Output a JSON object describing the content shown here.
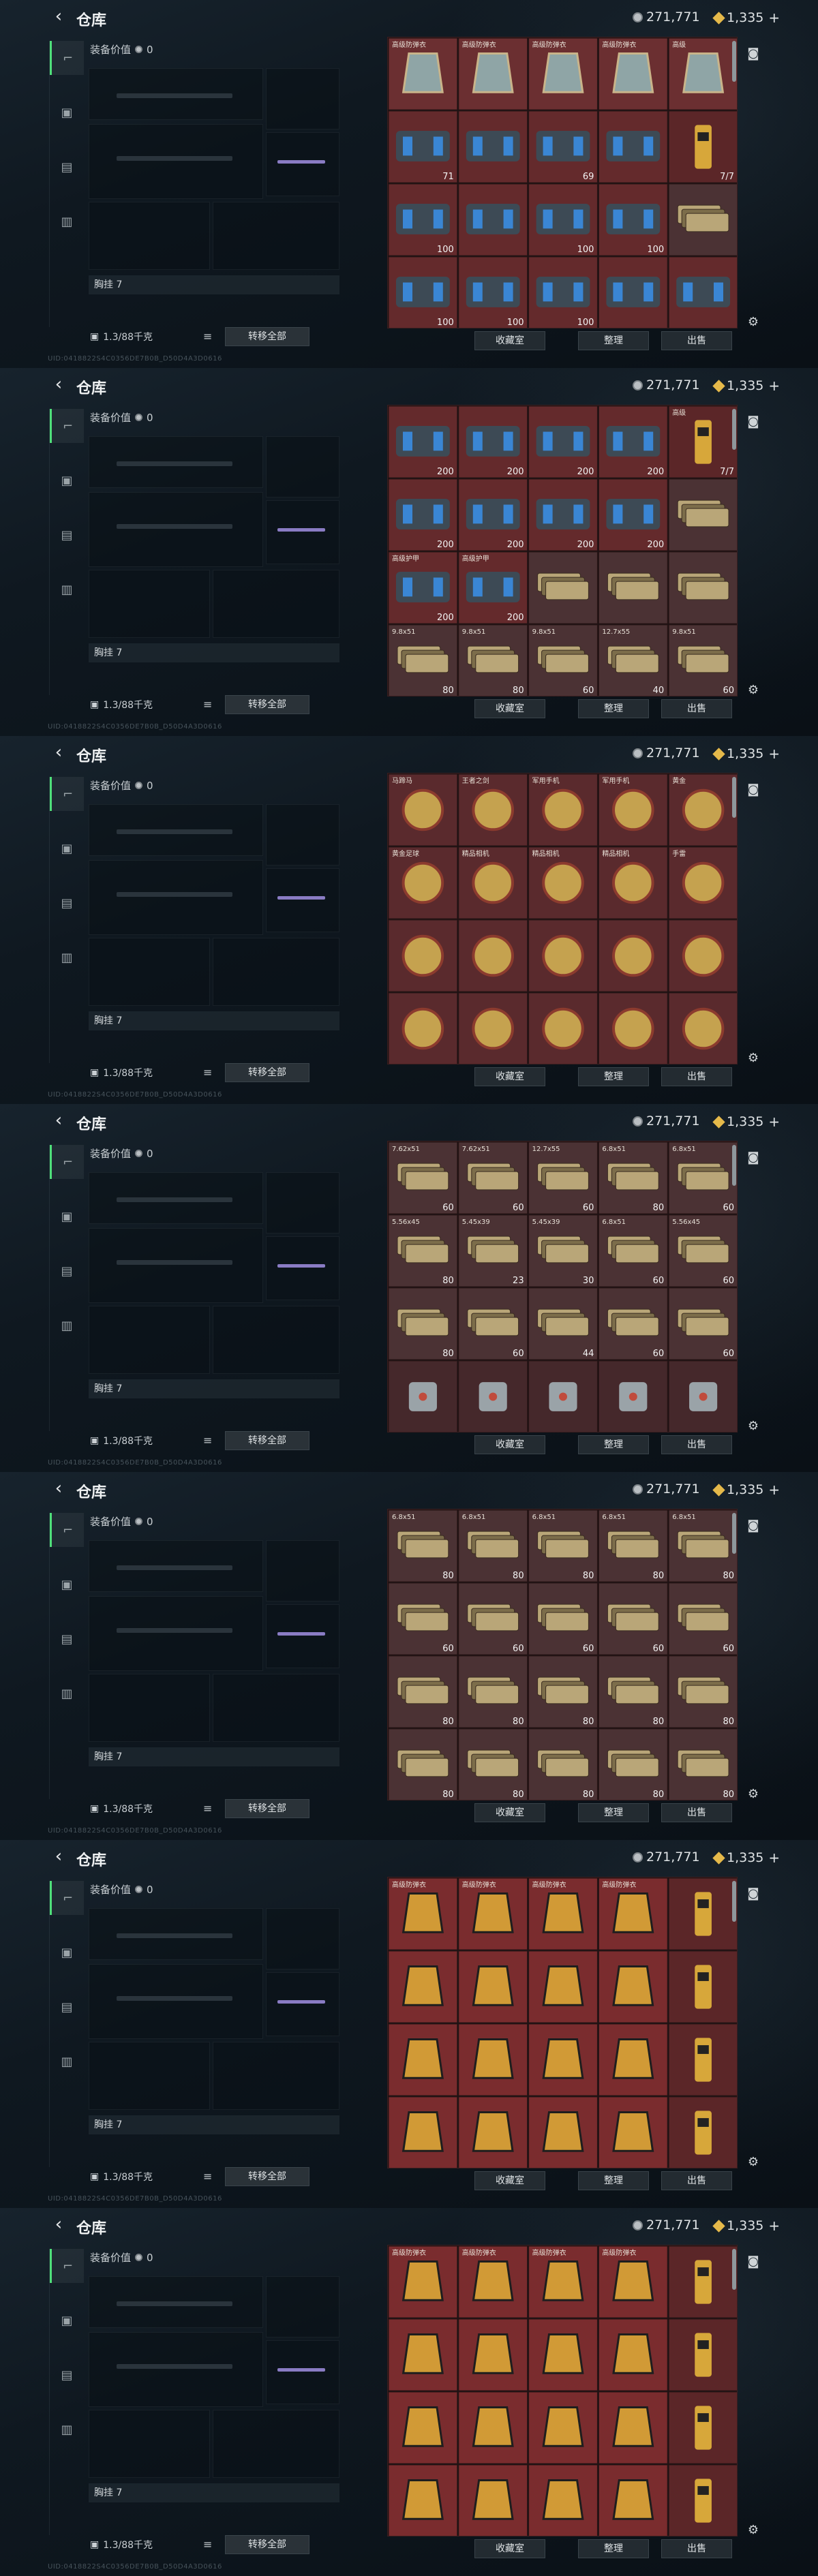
{
  "header": {
    "title": "仓库",
    "currency_1": "271,771",
    "currency_2": "1,335",
    "plus": "+"
  },
  "loadout": {
    "gear_value_label": "装备价值",
    "gear_value": "0",
    "chest_label": "胸挂 7",
    "capacity": "1.3/88千克",
    "transfer_all": "转移全部",
    "uid": "UID:0418822S4C0356DE7B0B_D50D4A3D0616"
  },
  "footer": {
    "collect": "收藏室",
    "organize": "整理",
    "sell": "出售"
  },
  "screens": [
    {
      "rows": [
        [
          "armor",
          "armor",
          "armor",
          "armor",
          "armor"
        ],
        [
          "case",
          "case",
          "case",
          "case",
          "tool"
        ],
        [
          "case",
          "case",
          "case",
          "case",
          "ammo"
        ],
        [
          "case",
          "case",
          "case",
          "case",
          "case"
        ]
      ],
      "labels": [
        [
          "高级防弹衣",
          "高级防弹衣",
          "高级防弹衣",
          "高级防弹衣",
          "高级"
        ],
        [
          "",
          "",
          "",
          "",
          ""
        ],
        [
          "",
          "",
          "",
          "",
          ""
        ],
        [
          "",
          "",
          "",
          "",
          ""
        ]
      ],
      "numbers": [
        [
          "",
          "",
          "",
          "",
          ""
        ],
        [
          "71",
          "",
          "69",
          "",
          "7/7"
        ],
        [
          "100",
          "",
          "100",
          "100",
          ""
        ],
        [
          "100",
          "100",
          "100",
          "",
          ""
        ]
      ]
    },
    {
      "rows": [
        [
          "case",
          "case",
          "case",
          "case",
          "tool"
        ],
        [
          "case",
          "case",
          "case",
          "case",
          "ammo"
        ],
        [
          "case",
          "case",
          "ammo",
          "ammo",
          "ammo"
        ],
        [
          "ammo",
          "ammo",
          "ammo",
          "ammo",
          "ammo"
        ]
      ],
      "labels": [
        [
          "",
          "",
          "",
          "",
          "高级"
        ],
        [
          "",
          "",
          "",
          "",
          ""
        ],
        [
          "高级护甲",
          "高级护甲",
          "",
          "",
          ""
        ],
        [
          "9.8x51",
          "9.8x51",
          "9.8x51",
          "12.7x55",
          "9.8x51"
        ]
      ],
      "numbers": [
        [
          "200",
          "200",
          "200",
          "200",
          "7/7"
        ],
        [
          "200",
          "200",
          "200",
          "200",
          ""
        ],
        [
          "200",
          "200",
          "",
          "",
          ""
        ],
        [
          "80",
          "80",
          "60",
          "40",
          "60"
        ]
      ]
    },
    {
      "rows": [
        [
          "relic",
          "relic",
          "relic",
          "relic",
          "relic"
        ],
        [
          "relic",
          "relic",
          "relic",
          "relic",
          "relic"
        ],
        [
          "relic",
          "relic",
          "relic",
          "relic",
          "relic"
        ],
        [
          "relic",
          "relic",
          "relic",
          "relic",
          "relic"
        ]
      ],
      "labels": [
        [
          "马蹄马",
          "王者之剑",
          "军用手机",
          "军用手机",
          "黄金"
        ],
        [
          "黄金足球",
          "精品相机",
          "精品相机",
          "精品相机",
          "手雷"
        ],
        [
          "",
          "",
          "",
          "",
          ""
        ],
        [
          "",
          "",
          "",
          "",
          ""
        ]
      ],
      "numbers": [
        [
          "",
          "",
          "",
          "",
          ""
        ],
        [
          "",
          "",
          "",
          "",
          ""
        ],
        [
          "",
          "",
          "",
          "",
          ""
        ],
        [
          "",
          "",
          "",
          "",
          ""
        ]
      ]
    },
    {
      "rows": [
        [
          "ammo",
          "ammo",
          "ammo",
          "ammo",
          "ammo"
        ],
        [
          "ammo",
          "ammo",
          "ammo",
          "ammo",
          "ammo"
        ],
        [
          "ammo",
          "ammo",
          "ammo",
          "ammo",
          "ammo"
        ],
        [
          "misc",
          "misc",
          "misc",
          "misc",
          "misc"
        ]
      ],
      "labels": [
        [
          "7.62x51",
          "7.62x51",
          "12.7x55",
          "6.8x51",
          "6.8x51"
        ],
        [
          "5.56x45",
          "5.45x39",
          "5.45x39",
          "6.8x51",
          "5.56x45"
        ],
        [
          "",
          "",
          "",
          "",
          ""
        ],
        [
          "",
          "",
          "",
          "",
          ""
        ]
      ],
      "numbers": [
        [
          "60",
          "60",
          "60",
          "80",
          "60"
        ],
        [
          "80",
          "23",
          "30",
          "60",
          "60"
        ],
        [
          "80",
          "60",
          "44",
          "60",
          "60"
        ],
        [
          "",
          "",
          "",
          "",
          ""
        ]
      ]
    },
    {
      "rows": [
        [
          "ammo",
          "ammo",
          "ammo",
          "ammo",
          "ammo"
        ],
        [
          "ammo",
          "ammo",
          "ammo",
          "ammo",
          "ammo"
        ],
        [
          "ammo",
          "ammo",
          "ammo",
          "ammo",
          "ammo"
        ],
        [
          "ammo",
          "ammo",
          "ammo",
          "ammo",
          "ammo"
        ]
      ],
      "labels": [
        [
          "6.8x51",
          "6.8x51",
          "6.8x51",
          "6.8x51",
          "6.8x51"
        ],
        [
          "",
          "",
          "",
          "",
          ""
        ],
        [
          "",
          "",
          "",
          "",
          ""
        ],
        [
          "",
          "",
          "",
          "",
          ""
        ]
      ],
      "numbers": [
        [
          "80",
          "80",
          "80",
          "80",
          "80"
        ],
        [
          "60",
          "60",
          "60",
          "60",
          "60"
        ],
        [
          "80",
          "80",
          "80",
          "80",
          "80"
        ],
        [
          "80",
          "80",
          "80",
          "80",
          "80"
        ]
      ]
    },
    {
      "rows": [
        [
          "vest",
          "vest",
          "vest",
          "vest",
          "tool"
        ],
        [
          "vest",
          "vest",
          "vest",
          "vest",
          "tool"
        ],
        [
          "vest",
          "vest",
          "vest",
          "vest",
          "tool"
        ],
        [
          "vest",
          "vest",
          "vest",
          "vest",
          "tool"
        ]
      ],
      "labels": [
        [
          "高级防弹衣",
          "高级防弹衣",
          "高级防弹衣",
          "高级防弹衣",
          ""
        ],
        [
          "",
          "",
          "",
          "",
          ""
        ],
        [
          "",
          "",
          "",
          "",
          ""
        ],
        [
          "",
          "",
          "",
          "",
          ""
        ]
      ],
      "numbers": [
        [
          "",
          "",
          "",
          "",
          ""
        ],
        [
          "",
          "",
          "",
          "",
          ""
        ],
        [
          "",
          "",
          "",
          "",
          ""
        ],
        [
          "",
          "",
          "",
          "",
          ""
        ]
      ]
    },
    {
      "rows": [
        [
          "vest",
          "vest",
          "vest",
          "vest",
          "tool"
        ],
        [
          "vest",
          "vest",
          "vest",
          "vest",
          "tool"
        ],
        [
          "vest",
          "vest",
          "vest",
          "vest",
          "tool"
        ],
        [
          "vest",
          "vest",
          "vest",
          "vest",
          "tool"
        ]
      ],
      "labels": [
        [
          "高级防弹衣",
          "高级防弹衣",
          "高级防弹衣",
          "高级防弹衣",
          ""
        ],
        [
          "",
          "",
          "",
          "",
          ""
        ],
        [
          "",
          "",
          "",
          "",
          ""
        ],
        [
          "",
          "",
          "",
          "",
          ""
        ]
      ],
      "numbers": [
        [
          "",
          "",
          "",
          "",
          ""
        ],
        [
          "",
          "",
          "",
          "",
          ""
        ],
        [
          "",
          "",
          "",
          "",
          ""
        ],
        [
          "",
          "",
          "",
          "",
          ""
        ]
      ]
    }
  ],
  "icons": {
    "back": "back-arrow-icon",
    "coin": "coin-icon",
    "diamond": "diamond-icon"
  }
}
